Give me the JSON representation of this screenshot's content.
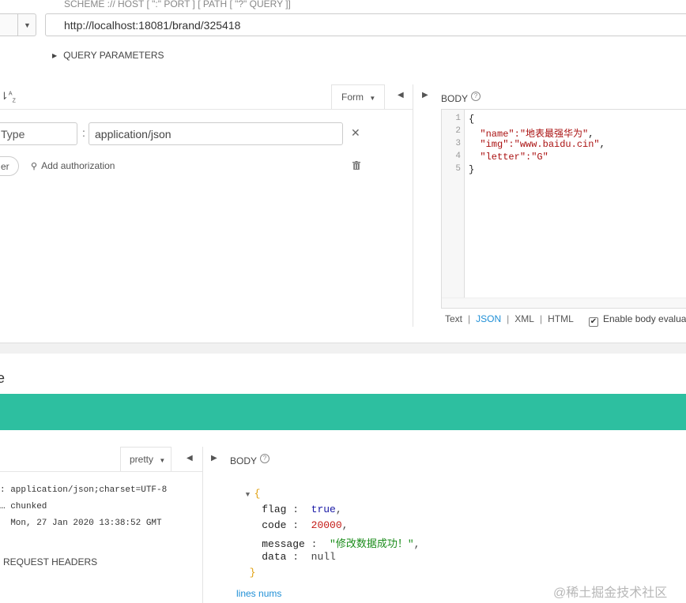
{
  "request": {
    "scheme_hint": "SCHEME :// HOST [ \":\" PORT ] [ PATH [ \"?\" QUERY ]]",
    "url": "http://localhost:18081/brand/325418",
    "query_parameters_label": "QUERY PARAMETERS"
  },
  "headers": {
    "form_label": "Form",
    "header_name": "Type",
    "header_value": "application/json",
    "add_header_label": "er",
    "add_authorization_label": "Add authorization"
  },
  "request_body": {
    "label": "BODY",
    "line_numbers": [
      "1",
      "2",
      "3",
      "4",
      "5"
    ],
    "lines": [
      {
        "pre": "{",
        "str": "",
        "post": ""
      },
      {
        "pre": "  ",
        "str": "\"name\":\"地表最强华为\"",
        "post": ","
      },
      {
        "pre": "  ",
        "str": "\"img\":\"www.baidu.cin\"",
        "post": ","
      },
      {
        "pre": "  ",
        "str": "\"letter\":\"G\"",
        "post": ""
      },
      {
        "pre": "}",
        "str": "",
        "post": ""
      }
    ],
    "formats": {
      "text": "Text",
      "json": "JSON",
      "xml": "XML",
      "html": "HTML",
      "active": "JSON"
    },
    "enable_eval_label": "Enable body evalua"
  },
  "response": {
    "title": "e",
    "status_color": "#2dbfa0",
    "pretty_label": "pretty",
    "headers": [
      ": application/json;charset=UTF-8",
      "… chunked",
      "  Mon, 27 Jan 2020 13:38:52 GMT"
    ],
    "request_headers_label": "REQUEST HEADERS",
    "body_label": "BODY",
    "json": {
      "open": "{",
      "close": "}",
      "flag_key": "flag",
      "flag_value": "true",
      "code_key": "code",
      "code_value": "20000",
      "message_key": "message",
      "message_value": "\"修改数据成功！\"",
      "data_key": "data",
      "data_value": "null"
    },
    "lines_nums_label": "lines nums"
  },
  "watermark": "@稀土掘金技术社区"
}
